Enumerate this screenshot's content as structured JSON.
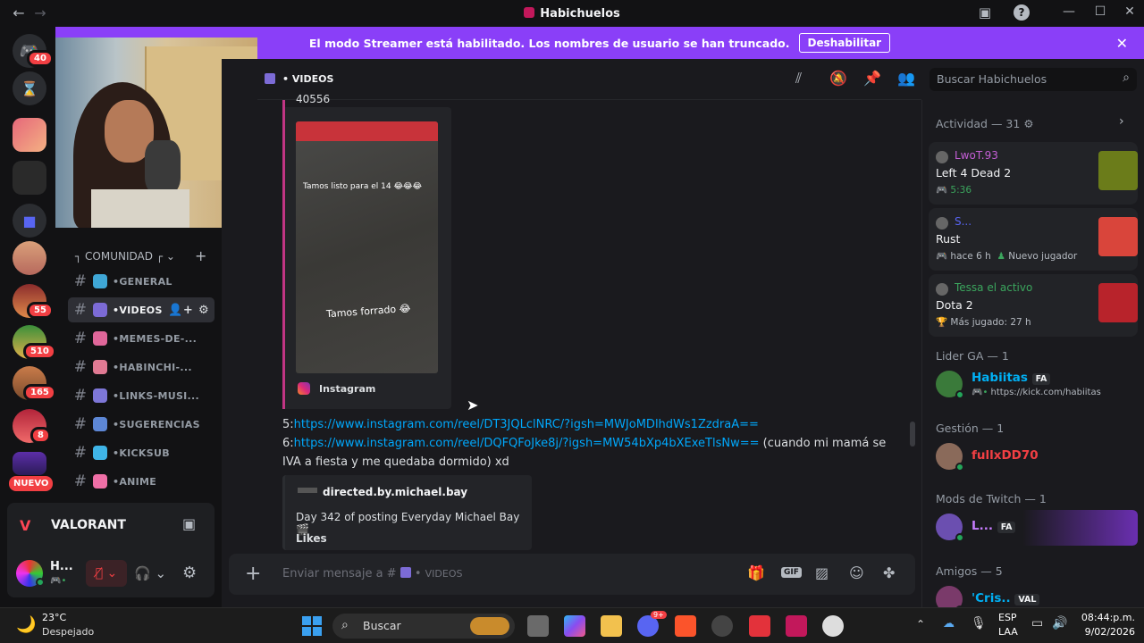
{
  "window": {
    "title": "Habichuelos"
  },
  "banner": {
    "text": "El modo Streamer está habilitado. Los nombres de usuario se han truncado.",
    "button": "Deshabilitar"
  },
  "servers": {
    "badges": [
      "40",
      "55",
      "510",
      "165",
      "8"
    ],
    "new_label": "NUEVO"
  },
  "channels": {
    "category": "COMUNIDAD",
    "items": [
      {
        "label": "GENERAL",
        "color": "#3fa7d6"
      },
      {
        "label": "VIDEOS",
        "color": "#7c6bd6"
      },
      {
        "label": "MEMES-DE-...",
        "color": "#e0679a"
      },
      {
        "label": "HABINCHI-...",
        "color": "#e07a93"
      },
      {
        "label": "LINKS-MUSI...",
        "color": "#7e77d8"
      },
      {
        "label": "SUGERENCIAS",
        "color": "#5d87d6"
      },
      {
        "label": "KICKSUB",
        "color": "#3fb5e8"
      },
      {
        "label": "ANIME",
        "color": "#ef6fa6"
      }
    ]
  },
  "game": {
    "name": "VALORANT"
  },
  "user": {
    "name": "H..."
  },
  "header": {
    "channel": "VIDEOS",
    "search_placeholder": "Buscar Habichuelos"
  },
  "messages": {
    "top_fragment": "40556",
    "embed1": {
      "overlay_top": "Tamos listo para el 14 😂😂😂",
      "overlay_bottom": "Tamos forrado 😂",
      "source": "Instagram"
    },
    "line5_prefix": "5:",
    "line5_link": "https://www.instagram.com/reel/DT3JQLclNRC/?igsh=MWJoMDlhdWs1ZzdraA==",
    "line6_prefix": "6:",
    "line6_link": "https://www.instagram.com/reel/DQFQFoJke8j/?igsh=MW54bXp4bXExeTlsNw==",
    "line6_suffix": " (cuando mi mamá se",
    "line6_wrap": "IVA a fiesta y me quedaba dormido) xd",
    "embed2": {
      "author": "directed.by.michael.bay",
      "desc": "Day 342 of posting Everyday Michael Bay 🎬",
      "likes": "Likes"
    }
  },
  "composer": {
    "placeholder": "Enviar mensaje a #",
    "channel": "VIDEOS"
  },
  "members": {
    "activity_title": "Actividad — 31",
    "activities": [
      {
        "user": "LwoT.93",
        "game": "Left 4 Dead 2",
        "meta": "5:36",
        "user_color": "#c45fd6"
      },
      {
        "user": "S...",
        "game": "Rust",
        "meta": "hace 6 h",
        "meta2": "Nuevo jugador",
        "user_color": "#5865f2"
      },
      {
        "user": "Tessa el activo",
        "game": "Dota 2",
        "meta": "Más jugado: 27 h",
        "user_color": "#3ba55d"
      }
    ],
    "sections": [
      {
        "title": "Lider GA — 1",
        "name": "Habiitas",
        "tag": "FA",
        "sub": "https://kick.com/habiitas",
        "color": "#00b0f4"
      },
      {
        "title": "Gestión — 1",
        "name": "fullxDD70",
        "color": "#f23f43"
      },
      {
        "title": "Mods de Twitch — 1",
        "name": "L...",
        "tag": "FA",
        "color": "#c77dff"
      },
      {
        "title": "Amigos — 5",
        "name": "'Cris..",
        "tag": "VAL",
        "color": "#00b0f4"
      }
    ]
  },
  "taskbar": {
    "weather_temp": "23°C",
    "weather_desc": "Despejado",
    "search": "Buscar",
    "lang1": "ESP",
    "lang2": "LAA",
    "time": "08:44:p.m.",
    "date": "9/02/2026",
    "discord_badge": "9+"
  }
}
